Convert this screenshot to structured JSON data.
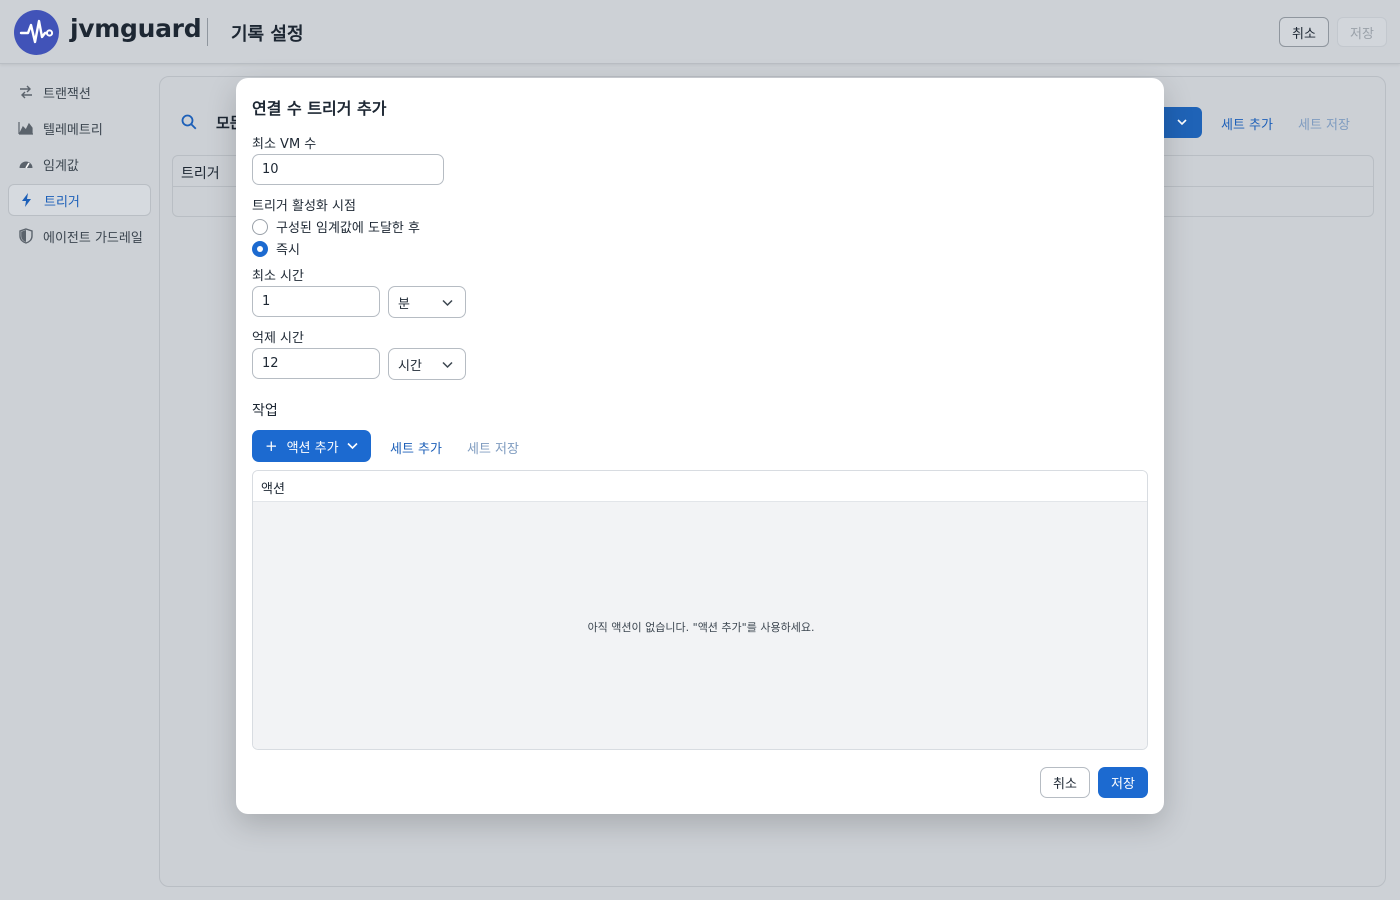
{
  "header": {
    "brand": "jvmguard",
    "page_title": "기록 설정",
    "cancel_label": "취소",
    "save_label": "저장"
  },
  "sidebar": {
    "items": [
      {
        "label": "트랜잭션",
        "icon": "transaction-arrows-icon",
        "active": false
      },
      {
        "label": "텔레메트리",
        "icon": "area-chart-icon",
        "active": false
      },
      {
        "label": "임계값",
        "icon": "gauge-icon",
        "active": false
      },
      {
        "label": "트리거",
        "icon": "lightning-icon",
        "active": true
      },
      {
        "label": "에이전트 가드레일",
        "icon": "shield-icon",
        "active": false
      }
    ]
  },
  "background": {
    "mode_label": "모든",
    "table_header": "트리거",
    "add_set_label": "세트 추가",
    "save_set_label": "세트 저장"
  },
  "modal": {
    "title": "연결 수 트리거 추가",
    "min_vm": {
      "label": "최소 VM 수",
      "value": "10"
    },
    "activation": {
      "label": "트리거 활성화 시점",
      "options": [
        "구성된 임계값에 도달한 후",
        "즉시"
      ],
      "selected": "즉시"
    },
    "min_time": {
      "label": "최소 시간",
      "value": "1",
      "unit": "분"
    },
    "suppress_time": {
      "label": "억제 시간",
      "value": "12",
      "unit": "시간"
    },
    "actions": {
      "section_title": "작업",
      "add_action_label": "액션 추가",
      "add_set_label": "세트 추가",
      "save_set_label": "세트 저장",
      "column_header": "액션",
      "empty_text": "아직 액션이 없습니다. \"액션 추가\"를 사용하세요."
    },
    "cancel_label": "취소",
    "save_label": "저장"
  },
  "colors": {
    "accent": "#1c6ad0",
    "link": "#1c5fb8",
    "logo": "#4153b8"
  }
}
